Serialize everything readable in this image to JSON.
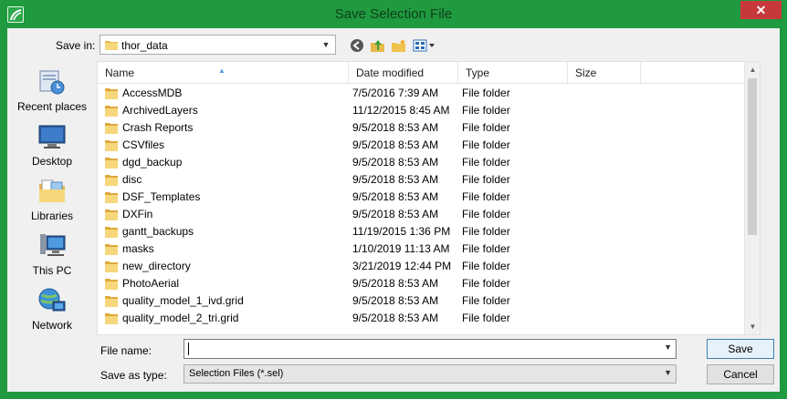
{
  "window": {
    "title": "Save Selection File",
    "close_glyph": "✕",
    "accent": "#1f9a3e"
  },
  "toolbar": {
    "save_in_label": "Save in:",
    "save_in_value": "thor_data",
    "icons": [
      "back-icon",
      "up-folder-icon",
      "new-folder-icon",
      "view-menu-icon"
    ]
  },
  "places": [
    {
      "label": "Recent places",
      "icon": "recent-places-icon"
    },
    {
      "label": "Desktop",
      "icon": "desktop-icon"
    },
    {
      "label": "Libraries",
      "icon": "libraries-icon"
    },
    {
      "label": "This PC",
      "icon": "this-pc-icon"
    },
    {
      "label": "Network",
      "icon": "network-icon"
    }
  ],
  "columns": {
    "name": "Name",
    "date": "Date modified",
    "type": "Type",
    "size": "Size"
  },
  "files": [
    {
      "name": "AccessMDB",
      "date": "7/5/2016 7:39 AM",
      "type": "File folder"
    },
    {
      "name": "ArchivedLayers",
      "date": "11/12/2015 8:45 AM",
      "type": "File folder"
    },
    {
      "name": "Crash Reports",
      "date": "9/5/2018 8:53 AM",
      "type": "File folder"
    },
    {
      "name": "CSVfiles",
      "date": "9/5/2018 8:53 AM",
      "type": "File folder"
    },
    {
      "name": "dgd_backup",
      "date": "9/5/2018 8:53 AM",
      "type": "File folder"
    },
    {
      "name": "disc",
      "date": "9/5/2018 8:53 AM",
      "type": "File folder"
    },
    {
      "name": "DSF_Templates",
      "date": "9/5/2018 8:53 AM",
      "type": "File folder"
    },
    {
      "name": "DXFin",
      "date": "9/5/2018 8:53 AM",
      "type": "File folder"
    },
    {
      "name": "gantt_backups",
      "date": "11/19/2015 1:36 PM",
      "type": "File folder"
    },
    {
      "name": "masks",
      "date": "1/10/2019 11:13 AM",
      "type": "File folder"
    },
    {
      "name": "new_directory",
      "date": "3/21/2019 12:44 PM",
      "type": "File folder"
    },
    {
      "name": "PhotoAerial",
      "date": "9/5/2018 8:53 AM",
      "type": "File folder"
    },
    {
      "name": "quality_model_1_ivd.grid",
      "date": "9/5/2018 8:53 AM",
      "type": "File folder"
    },
    {
      "name": "quality_model_2_tri.grid",
      "date": "9/5/2018 8:53 AM",
      "type": "File folder"
    }
  ],
  "bottom": {
    "file_name_label": "File name:",
    "file_name_value": "",
    "save_as_type_label": "Save as type:",
    "save_as_type_value": "Selection Files (*.sel)",
    "save_button": "Save",
    "cancel_button": "Cancel"
  }
}
